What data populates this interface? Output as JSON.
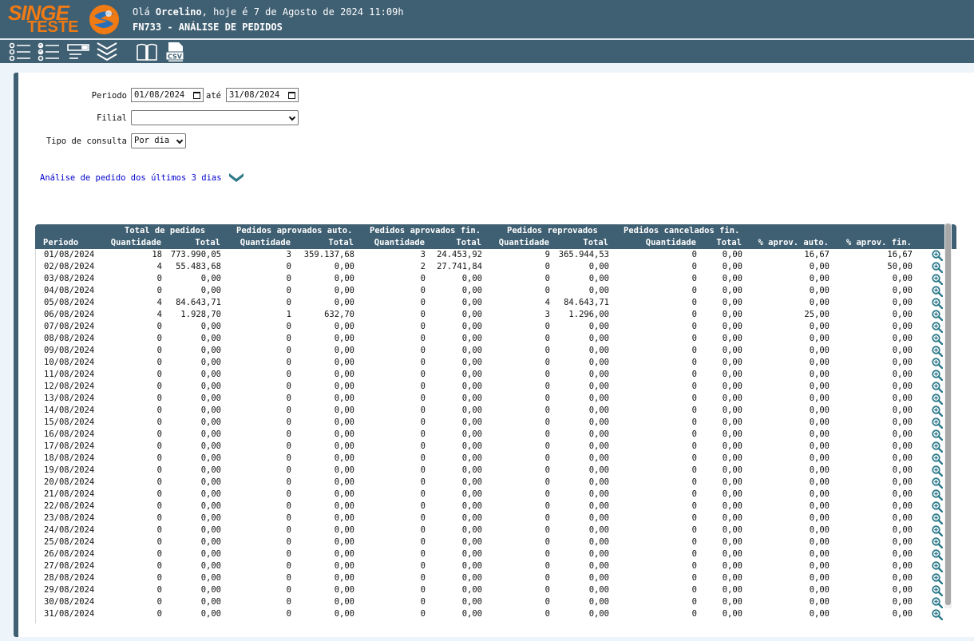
{
  "header": {
    "logo_line1": "SINGE",
    "logo_line2": "TESTE",
    "greeting_prefix": "Olá ",
    "user_name": "Orcelino",
    "greeting_suffix": ", hoje é 7 de Agosto de 2024 11:09h",
    "screen_title": "FN733 - ANÁLISE DE PEDIDOS"
  },
  "toolbar": {
    "items": [
      "list-icon",
      "checklist-icon",
      "form-icon",
      "collapse-icon",
      "book-icon",
      "csv-icon"
    ],
    "csv_label": "CSV"
  },
  "filters": {
    "periodo_label": "Periodo",
    "periodo_inicio": "01/08/2024",
    "ate_label": "até",
    "periodo_fim": "31/08/2024",
    "filial_label": "Filial",
    "filial_value": "",
    "tipo_label": "Tipo de consulta",
    "tipo_value": "Por dia"
  },
  "analise_link": "Análise de pedido dos últimos 3 dias",
  "table": {
    "group_headers": [
      "Total de pedidos",
      "Pedidos aprovados auto.",
      "Pedidos aprovados fin.",
      "Pedidos reprovados",
      "Pedidos cancelados fin."
    ],
    "columns": [
      "Periodo",
      "Quantidade",
      "Total",
      "Quantidade",
      "Total",
      "Quantidade",
      "Total",
      "Quantidade",
      "Total",
      "Quantidade",
      "Total",
      "% aprov. auto.",
      "% aprov. fin."
    ],
    "rows": [
      [
        "01/08/2024",
        "18",
        "773.990,05",
        "3",
        "359.137,68",
        "3",
        "24.453,92",
        "9",
        "365.944,53",
        "0",
        "0,00",
        "16,67",
        "16,67"
      ],
      [
        "02/08/2024",
        "4",
        "55.483,68",
        "0",
        "0,00",
        "2",
        "27.741,84",
        "0",
        "0,00",
        "0",
        "0,00",
        "0,00",
        "50,00"
      ],
      [
        "03/08/2024",
        "0",
        "0,00",
        "0",
        "0,00",
        "0",
        "0,00",
        "0",
        "0,00",
        "0",
        "0,00",
        "0,00",
        "0,00"
      ],
      [
        "04/08/2024",
        "0",
        "0,00",
        "0",
        "0,00",
        "0",
        "0,00",
        "0",
        "0,00",
        "0",
        "0,00",
        "0,00",
        "0,00"
      ],
      [
        "05/08/2024",
        "4",
        "84.643,71",
        "0",
        "0,00",
        "0",
        "0,00",
        "4",
        "84.643,71",
        "0",
        "0,00",
        "0,00",
        "0,00"
      ],
      [
        "06/08/2024",
        "4",
        "1.928,70",
        "1",
        "632,70",
        "0",
        "0,00",
        "3",
        "1.296,00",
        "0",
        "0,00",
        "25,00",
        "0,00"
      ],
      [
        "07/08/2024",
        "0",
        "0,00",
        "0",
        "0,00",
        "0",
        "0,00",
        "0",
        "0,00",
        "0",
        "0,00",
        "0,00",
        "0,00"
      ],
      [
        "08/08/2024",
        "0",
        "0,00",
        "0",
        "0,00",
        "0",
        "0,00",
        "0",
        "0,00",
        "0",
        "0,00",
        "0,00",
        "0,00"
      ],
      [
        "09/08/2024",
        "0",
        "0,00",
        "0",
        "0,00",
        "0",
        "0,00",
        "0",
        "0,00",
        "0",
        "0,00",
        "0,00",
        "0,00"
      ],
      [
        "10/08/2024",
        "0",
        "0,00",
        "0",
        "0,00",
        "0",
        "0,00",
        "0",
        "0,00",
        "0",
        "0,00",
        "0,00",
        "0,00"
      ],
      [
        "11/08/2024",
        "0",
        "0,00",
        "0",
        "0,00",
        "0",
        "0,00",
        "0",
        "0,00",
        "0",
        "0,00",
        "0,00",
        "0,00"
      ],
      [
        "12/08/2024",
        "0",
        "0,00",
        "0",
        "0,00",
        "0",
        "0,00",
        "0",
        "0,00",
        "0",
        "0,00",
        "0,00",
        "0,00"
      ],
      [
        "13/08/2024",
        "0",
        "0,00",
        "0",
        "0,00",
        "0",
        "0,00",
        "0",
        "0,00",
        "0",
        "0,00",
        "0,00",
        "0,00"
      ],
      [
        "14/08/2024",
        "0",
        "0,00",
        "0",
        "0,00",
        "0",
        "0,00",
        "0",
        "0,00",
        "0",
        "0,00",
        "0,00",
        "0,00"
      ],
      [
        "15/08/2024",
        "0",
        "0,00",
        "0",
        "0,00",
        "0",
        "0,00",
        "0",
        "0,00",
        "0",
        "0,00",
        "0,00",
        "0,00"
      ],
      [
        "16/08/2024",
        "0",
        "0,00",
        "0",
        "0,00",
        "0",
        "0,00",
        "0",
        "0,00",
        "0",
        "0,00",
        "0,00",
        "0,00"
      ],
      [
        "17/08/2024",
        "0",
        "0,00",
        "0",
        "0,00",
        "0",
        "0,00",
        "0",
        "0,00",
        "0",
        "0,00",
        "0,00",
        "0,00"
      ],
      [
        "18/08/2024",
        "0",
        "0,00",
        "0",
        "0,00",
        "0",
        "0,00",
        "0",
        "0,00",
        "0",
        "0,00",
        "0,00",
        "0,00"
      ],
      [
        "19/08/2024",
        "0",
        "0,00",
        "0",
        "0,00",
        "0",
        "0,00",
        "0",
        "0,00",
        "0",
        "0,00",
        "0,00",
        "0,00"
      ],
      [
        "20/08/2024",
        "0",
        "0,00",
        "0",
        "0,00",
        "0",
        "0,00",
        "0",
        "0,00",
        "0",
        "0,00",
        "0,00",
        "0,00"
      ],
      [
        "21/08/2024",
        "0",
        "0,00",
        "0",
        "0,00",
        "0",
        "0,00",
        "0",
        "0,00",
        "0",
        "0,00",
        "0,00",
        "0,00"
      ],
      [
        "22/08/2024",
        "0",
        "0,00",
        "0",
        "0,00",
        "0",
        "0,00",
        "0",
        "0,00",
        "0",
        "0,00",
        "0,00",
        "0,00"
      ],
      [
        "23/08/2024",
        "0",
        "0,00",
        "0",
        "0,00",
        "0",
        "0,00",
        "0",
        "0,00",
        "0",
        "0,00",
        "0,00",
        "0,00"
      ],
      [
        "24/08/2024",
        "0",
        "0,00",
        "0",
        "0,00",
        "0",
        "0,00",
        "0",
        "0,00",
        "0",
        "0,00",
        "0,00",
        "0,00"
      ],
      [
        "25/08/2024",
        "0",
        "0,00",
        "0",
        "0,00",
        "0",
        "0,00",
        "0",
        "0,00",
        "0",
        "0,00",
        "0,00",
        "0,00"
      ],
      [
        "26/08/2024",
        "0",
        "0,00",
        "0",
        "0,00",
        "0",
        "0,00",
        "0",
        "0,00",
        "0",
        "0,00",
        "0,00",
        "0,00"
      ],
      [
        "27/08/2024",
        "0",
        "0,00",
        "0",
        "0,00",
        "0",
        "0,00",
        "0",
        "0,00",
        "0",
        "0,00",
        "0,00",
        "0,00"
      ],
      [
        "28/08/2024",
        "0",
        "0,00",
        "0",
        "0,00",
        "0",
        "0,00",
        "0",
        "0,00",
        "0",
        "0,00",
        "0,00",
        "0,00"
      ],
      [
        "29/08/2024",
        "0",
        "0,00",
        "0",
        "0,00",
        "0",
        "0,00",
        "0",
        "0,00",
        "0",
        "0,00",
        "0,00",
        "0,00"
      ],
      [
        "30/08/2024",
        "0",
        "0,00",
        "0",
        "0,00",
        "0",
        "0,00",
        "0",
        "0,00",
        "0",
        "0,00",
        "0,00",
        "0,00"
      ],
      [
        "31/08/2024",
        "0",
        "0,00",
        "0",
        "0,00",
        "0",
        "0,00",
        "0",
        "0,00",
        "0",
        "0,00",
        "0,00",
        "0,00"
      ]
    ],
    "row_action_icon": "zoom-in-icon"
  },
  "colors": {
    "header_bg": "#3f5f72",
    "logo_orange": "#f07a14",
    "link_blue": "#0000cc",
    "icon_teal": "#2d7a8a"
  }
}
